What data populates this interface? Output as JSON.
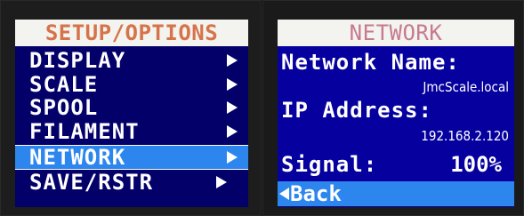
{
  "setup_screen": {
    "title": "SETUP/OPTIONS",
    "items": [
      {
        "label": "DISPLAY",
        "icon": "play-arrow-icon"
      },
      {
        "label": "SCALE",
        "icon": "play-arrow-icon"
      },
      {
        "label": "SPOOL",
        "icon": "play-arrow-icon"
      },
      {
        "label": "FILAMENT",
        "icon": "play-arrow-icon"
      },
      {
        "label": "NETWORK",
        "icon": "play-arrow-icon",
        "selected": true
      },
      {
        "label": "SAVE/RSTR",
        "icon": "play-arrow-icon"
      }
    ]
  },
  "network_screen": {
    "title": "NETWORK",
    "network_name_label": "Network Name:",
    "network_name_value": "JmcScale.local",
    "ip_label": "IP Address:",
    "ip_value": "192.168.2.120",
    "signal_label": "Signal:",
    "signal_value": "100%",
    "back_label": "Back",
    "back_icon": "back-arrow-icon"
  },
  "colors": {
    "screen_bg_left": "#04006a",
    "screen_bg_right": "#06009e",
    "highlight": "#2d86ee",
    "title_bg": "#f3f3ef",
    "title_left": "#d6734a",
    "title_right": "#c67a8e"
  }
}
